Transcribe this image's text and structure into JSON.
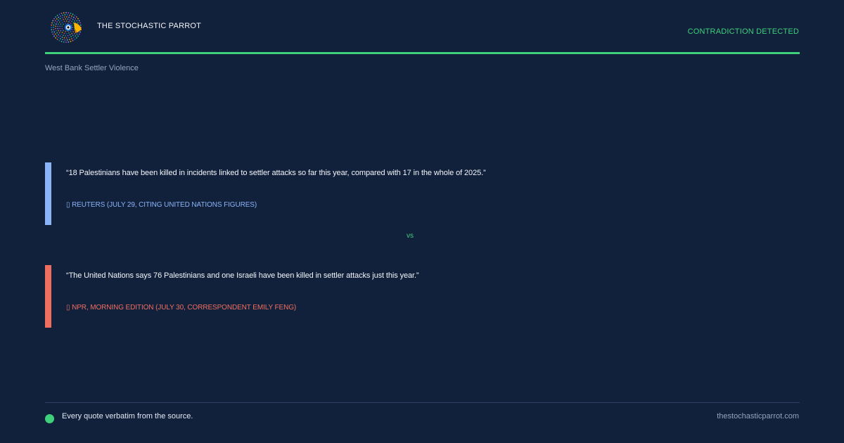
{
  "header": {
    "brand": "THE STOCHASTIC PARROT",
    "status": "CONTRADICTION DETECTED",
    "logo_icon": "parrot-logo-icon"
  },
  "topic": "West Bank Settler Violence",
  "claims": [
    {
      "quote": "“18 Palestinians have been killed in incidents linked to settler attacks so far this year, compared with 17 in the whole of 2025.”",
      "source": "▯ REUTERS (JULY 29, CITING UNITED NATIONS FIGURES)",
      "color": "#89b4f8"
    },
    {
      "quote": "“The United Nations says 76 Palestinians and one Israeli have been killed in settler attacks just this year.”",
      "source": "▯ NPR, MORNING EDITION (JULY 30, CORRESPONDENT EMILY FENG)",
      "color": "#f06e5f"
    }
  ],
  "vs_label": "vs",
  "footer": {
    "note": "Every quote verbatim from the source.",
    "site": "thestochasticparrot.com"
  },
  "colors": {
    "background": "#12213b",
    "accent": "#3ed07b",
    "claim_a": "#89b4f8",
    "claim_b": "#f06e5f"
  }
}
